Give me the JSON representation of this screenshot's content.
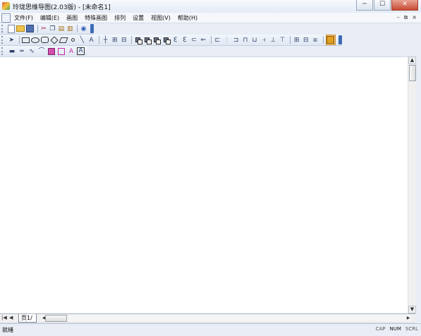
{
  "window": {
    "title": "玲珑思维导图(2.03版) - [未命名1]",
    "controls": {
      "minimize": "─",
      "maximize": "☐",
      "close": "✕"
    }
  },
  "menubar": {
    "items": [
      "文件(F)",
      "编辑(E)",
      "画图",
      "特殊画图",
      "排列",
      "设置",
      "视图(V)",
      "帮助(H)"
    ],
    "mdi_controls": {
      "minimize": "–",
      "restore": "⧉",
      "close": "×"
    }
  },
  "toolbar_standard": {
    "icons": [
      "new-icon",
      "open-icon",
      "save-icon",
      "cut-icon",
      "copy-icon",
      "paste-icon",
      "paste-special-icon",
      "help-icon"
    ]
  },
  "toolbar_draw": {
    "icons": [
      "select-arrow-icon",
      "rectangle-icon",
      "ellipse-icon",
      "rounded-rect-icon",
      "diamond-icon",
      "parallelogram-icon",
      "point-icon",
      "line-icon",
      "text-icon",
      "cross-icon",
      "grid-icon",
      "split-icon",
      "bring-front-icon",
      "send-back-icon",
      "group-icon",
      "ungroup-icon",
      "branch-left-icon",
      "branch-right-icon",
      "arrow-left-icon",
      "arrow-left-2-icon",
      "align-left-icon",
      "align-center-icon",
      "align-right-icon",
      "align-top-icon",
      "align-middle-icon",
      "align-bottom-icon",
      "distribute-h-icon",
      "distribute-v-icon",
      "layout-1-icon",
      "layout-2-icon",
      "layout-3-icon",
      "lock-icon"
    ],
    "labels": {
      "text_tool": "A",
      "branch": "ℇ",
      "arrow": "⊂"
    }
  },
  "toolbar_format": {
    "icons": [
      "thick-line-icon",
      "double-line-icon",
      "wave-icon",
      "curve-icon",
      "fill-color-icon",
      "border-color-icon",
      "font-color-icon",
      "text-box-icon"
    ],
    "labels": {
      "font_color": "A",
      "text_box": "A"
    }
  },
  "tabs": {
    "nav": [
      "|◀",
      "◀",
      "▶",
      "▶|"
    ],
    "pages": [
      "页1"
    ],
    "separator": "/"
  },
  "status": {
    "text": "就绪",
    "indicators": [
      {
        "label": "CAP",
        "active": false
      },
      {
        "label": "NUM",
        "active": true
      },
      {
        "label": "SCRL",
        "active": false
      }
    ]
  },
  "colors": {
    "accent": "#3d6bb3",
    "lock": "#e0a020",
    "magenta": "#d64db0"
  }
}
